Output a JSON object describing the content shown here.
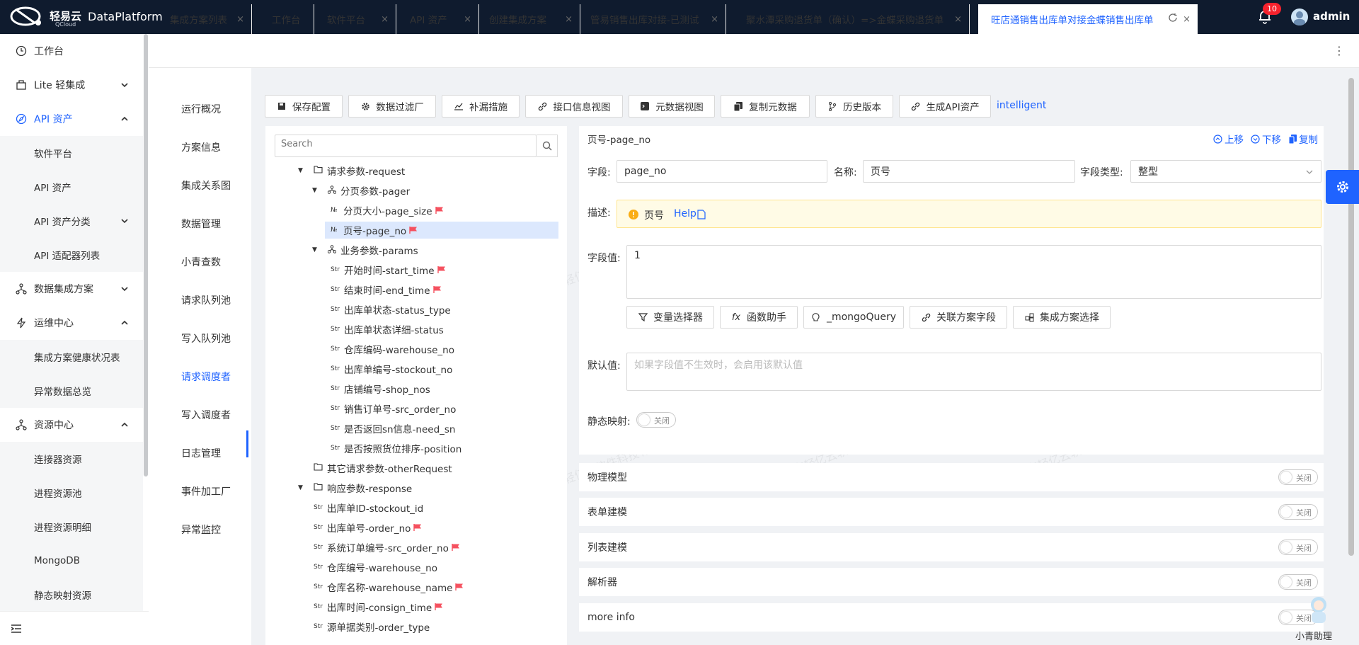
{
  "header": {
    "logo_text": "轻易云",
    "logo_sub": "QCloud",
    "app_title": "DataPlatform",
    "notification_count": "10",
    "user": "admin"
  },
  "sidebar": {
    "items": [
      {
        "label": "工作台",
        "icon": "clock-icon"
      },
      {
        "label": "Lite 轻集成",
        "icon": "box-icon"
      },
      {
        "label": "API 资产",
        "icon": "compass-icon"
      },
      {
        "label": "软件平台"
      },
      {
        "label": "API 资产"
      },
      {
        "label": "API 资产分类"
      },
      {
        "label": "API 适配器列表"
      },
      {
        "label": "数据集成方案",
        "icon": "network-icon"
      },
      {
        "label": "运维中心",
        "icon": "bolt-icon"
      },
      {
        "label": "集成方案健康状况表"
      },
      {
        "label": "异常数据总览"
      },
      {
        "label": "资源中心",
        "icon": "network-icon"
      },
      {
        "label": "连接器资源"
      },
      {
        "label": "进程资源池"
      },
      {
        "label": "进程资源明细"
      },
      {
        "label": "MongoDB"
      },
      {
        "label": "静态映射资源"
      }
    ]
  },
  "tabs": [
    {
      "label": "集成方案列表"
    },
    {
      "label": "工作台"
    },
    {
      "label": "软件平台"
    },
    {
      "label": "API 资产"
    },
    {
      "label": "创建集成方案"
    },
    {
      "label": "管易销售出库对接-已测试"
    },
    {
      "label": "聚水潭采购退货单（确认）=>金蝶采购退货单"
    },
    {
      "label": "旺店通销售出库单对接金蝶销售出库单"
    }
  ],
  "left_menu": [
    "运行概况",
    "方案信息",
    "集成关系图",
    "数据管理",
    "小青查数",
    "请求队列池",
    "写入队列池",
    "请求调度者",
    "写入调度者",
    "日志管理",
    "事件加工厂",
    "异常监控"
  ],
  "toolbar": {
    "buttons": [
      "保存配置",
      "数据过滤厂",
      "补漏措施",
      "接口信息视图",
      "元数据视图",
      "复制元数据",
      "历史版本",
      "生成API资产"
    ],
    "intelligent": "intelligent"
  },
  "tree": {
    "search_placeholder": "Search",
    "nodes": [
      {
        "label": "请求参数-request",
        "type": "folder"
      },
      {
        "label": "分页参数-pager",
        "type": "group"
      },
      {
        "label": "分页大小-page_size",
        "type": "num"
      },
      {
        "label": "页号-page_no",
        "type": "num"
      },
      {
        "label": "业务参数-params",
        "type": "group"
      },
      {
        "label": "开始时间-start_time",
        "type": "str"
      },
      {
        "label": "结束时间-end_time",
        "type": "str"
      },
      {
        "label": "出库单状态-status_type",
        "type": "str"
      },
      {
        "label": "出库单状态详细-status",
        "type": "str"
      },
      {
        "label": "仓库编码-warehouse_no",
        "type": "str"
      },
      {
        "label": "出库单编号-stockout_no",
        "type": "str"
      },
      {
        "label": "店铺编号-shop_nos",
        "type": "str"
      },
      {
        "label": "销售订单号-src_order_no",
        "type": "str"
      },
      {
        "label": "是否返回sn信息-need_sn",
        "type": "str"
      },
      {
        "label": "是否按照货位排序-position",
        "type": "str"
      },
      {
        "label": "其它请求参数-otherRequest",
        "type": "folder"
      },
      {
        "label": "响应参数-response",
        "type": "folder"
      },
      {
        "label": "出库单ID-stockout_id",
        "type": "str"
      },
      {
        "label": "出库单号-order_no",
        "type": "str"
      },
      {
        "label": "系统订单编号-src_order_no",
        "type": "str"
      },
      {
        "label": "仓库编号-warehouse_no",
        "type": "str"
      },
      {
        "label": "仓库名称-warehouse_name",
        "type": "str"
      },
      {
        "label": "出库时间-consign_time",
        "type": "str"
      },
      {
        "label": "源单据类别-order_type",
        "type": "str"
      }
    ],
    "type_labels": {
      "num": "№",
      "str": "Str"
    }
  },
  "detail": {
    "title": "页号-page_no",
    "move_up": "上移",
    "move_down": "下移",
    "copy": "复制",
    "field_label": "字段:",
    "field_value": "page_no",
    "name_label": "名称:",
    "name_value": "页号",
    "type_label": "字段类型:",
    "type_value": "整型",
    "desc_label": "描述:",
    "desc_text": "页号",
    "help": "Help",
    "value_label": "字段值:",
    "value_text": "1",
    "action_buttons": [
      "变量选择器",
      "函数助手",
      "_mongoQuery",
      "关联方案字段",
      "集成方案选择"
    ],
    "default_label": "默认值:",
    "default_placeholder": "如果字段值不生效时，会启用该默认值",
    "static_map_label": "静态映射:",
    "toggle_off": "关闭"
  },
  "sections": [
    "物理模型",
    "表单建模",
    "列表建模",
    "解析器",
    "more info"
  ],
  "assistant_label": "小青助理",
  "watermark": "广东轻亿云软件科技有限公司",
  "colors": {
    "accent": "#1f63ff",
    "header_bg": "#0f1b2e",
    "badge": "#f5222d",
    "flag": "#f5515f"
  }
}
